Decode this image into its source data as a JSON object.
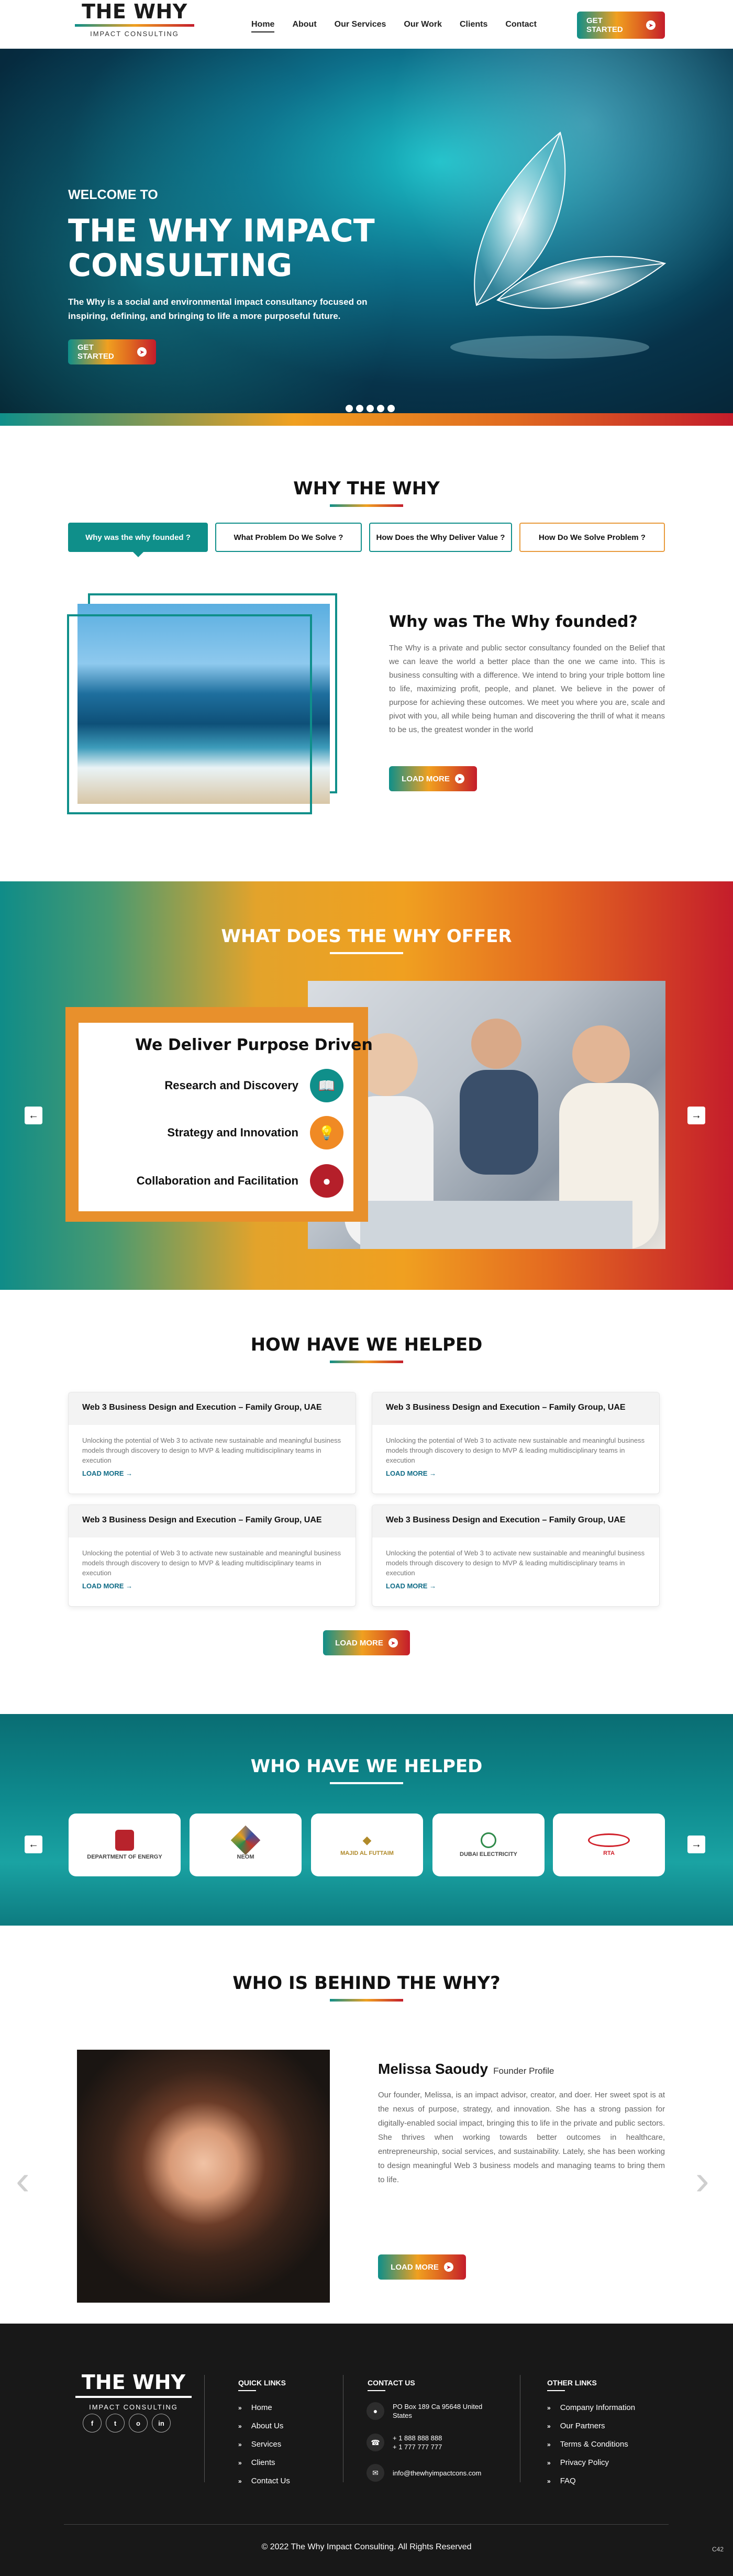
{
  "header": {
    "logo_title": "THE WHY",
    "logo_subtitle": "IMPACT CONSULTING",
    "nav": [
      "Home",
      "About",
      "Our Services",
      "Our Work",
      "Clients",
      "Contact"
    ],
    "cta": "GET STARTED"
  },
  "hero": {
    "welcome": "WELCOME TO",
    "title": "THE WHY IMPACT CONSULTING",
    "description": "The Why is a social and environmental impact consultancy focused on inspiring, defining, and bringing to life a more purposeful future.",
    "cta": "GET STARTED",
    "slides": 5
  },
  "why": {
    "title": "WHY THE WHY",
    "tabs": [
      "Why was the why founded ?",
      "What Problem Do We Solve ?",
      "How Does the Why Deliver Value ?",
      "How Do We Solve Problem ?"
    ],
    "heading": "Why was The  Why founded?",
    "text": "The Why is a private and public sector consultancy founded  on the Belief that we can leave the world a better place than  the one we came into. This is business consulting with a difference. We intend to bring your triple bottom line to life, maximizing  profit, people, and planet. We believe in the power of purpose  for achieving these outcomes. We meet you where you are, scale and pivot with you, all  while being human and discovering the thrill of what it means to be us, the greatest wonder in the world",
    "cta": "LOAD MORE"
  },
  "offer": {
    "title": "WHAT DOES THE WHY OFFER",
    "heading": "We Deliver Purpose Driven",
    "items": [
      {
        "label": "Research and Discovery",
        "color": "#0f8f8a",
        "icon": "book-icon"
      },
      {
        "label": "Strategy and Innovation",
        "color": "#f08a24",
        "icon": "lightbulb-gear-icon"
      },
      {
        "label": "Collaboration and Facilitation",
        "color": "#b51f2a",
        "icon": "team-icon"
      }
    ]
  },
  "helped": {
    "title": "HOW HAVE WE HELPED",
    "cards": [
      {
        "title": "Web 3 Business Design and Execution – Family Group, UAE",
        "text": "Unlocking the potential of Web 3 to activate new sustainable and meaningful business models through discovery to design to MVP & leading multidisciplinary teams in execution",
        "link": "LOAD MORE"
      },
      {
        "title": "Web 3 Business Design and Execution – Family Group, UAE",
        "text": "Unlocking the potential of Web 3 to activate new sustainable and meaningful business models through discovery to design to MVP & leading multidisciplinary teams in execution",
        "link": "LOAD MORE"
      },
      {
        "title": "Web 3 Business Design and Execution – Family Group, UAE",
        "text": "Unlocking the potential of Web 3 to activate new sustainable and meaningful business models through discovery to design to MVP & leading multidisciplinary teams in execution",
        "link": "LOAD MORE"
      },
      {
        "title": "Web 3 Business Design and Execution – Family Group, UAE",
        "text": "Unlocking the potential of Web 3 to activate new sustainable and meaningful business models through discovery to design to MVP & leading multidisciplinary teams in execution",
        "link": "LOAD MORE"
      }
    ],
    "cta": "LOAD MORE"
  },
  "clients": {
    "title": "WHO HAVE WE HELPED",
    "logos": [
      {
        "name": "DEPARTMENT OF ENERGY",
        "icon": "emblem-icon",
        "color": "#b8232c"
      },
      {
        "name": "NEOM",
        "icon": "neom-icon",
        "color": "#3a4fa0"
      },
      {
        "name": "MAJID AL FUTTAIM",
        "icon": "maf-icon",
        "color": "#b08a2a"
      },
      {
        "name": "DUBAI ELECTRICITY",
        "icon": "dewa-icon",
        "color": "#2f8a4a"
      },
      {
        "name": "RTA",
        "icon": "rta-icon",
        "color": "#d0202a"
      }
    ]
  },
  "behind": {
    "title": "WHO IS BEHIND THE WHY?",
    "name": "Melissa Saoudy",
    "role": "Founder Profile",
    "text": "Our founder, Melissa, is an impact advisor, creator, and doer. Her  sweet spot is at the nexus of purpose, strategy, and innovation.  She has a strong passion for digitally-enabled social impact,  bringing this to life in the private and public sectors. She thrives when working towards better outcomes  in healthcare, entrepreneurship, social services, and sustainability. Lately, she has been working to design meaningful Web 3 business models and managing teams to bring them to life.",
    "cta": "LOAD MORE"
  },
  "footer": {
    "logo_title": "THE WHY",
    "logo_subtitle": "IMPACT CONSULTING",
    "socials": [
      "f",
      "t",
      "o",
      "in"
    ],
    "quick_links_title": "QUICK LINKS",
    "quick_links": [
      "Home",
      "About Us",
      "Services",
      "Clients",
      "Contact Us"
    ],
    "contact_title": "CONTACT US",
    "address": "PO Box 189 Ca 95648 United States",
    "phones": "+ 1 888 888 888\n+ 1 777 777 777",
    "email": "info@thewhyimpactcons.com",
    "other_title": "OTHER LINKS",
    "other_links": [
      "Company Information",
      "Our Partners",
      "Terms & Conditions",
      "Privacy Policy",
      "FAQ"
    ],
    "copyright": "© 2022  The Why Impact Consulting. All Rights Reserved",
    "code": "C42"
  }
}
